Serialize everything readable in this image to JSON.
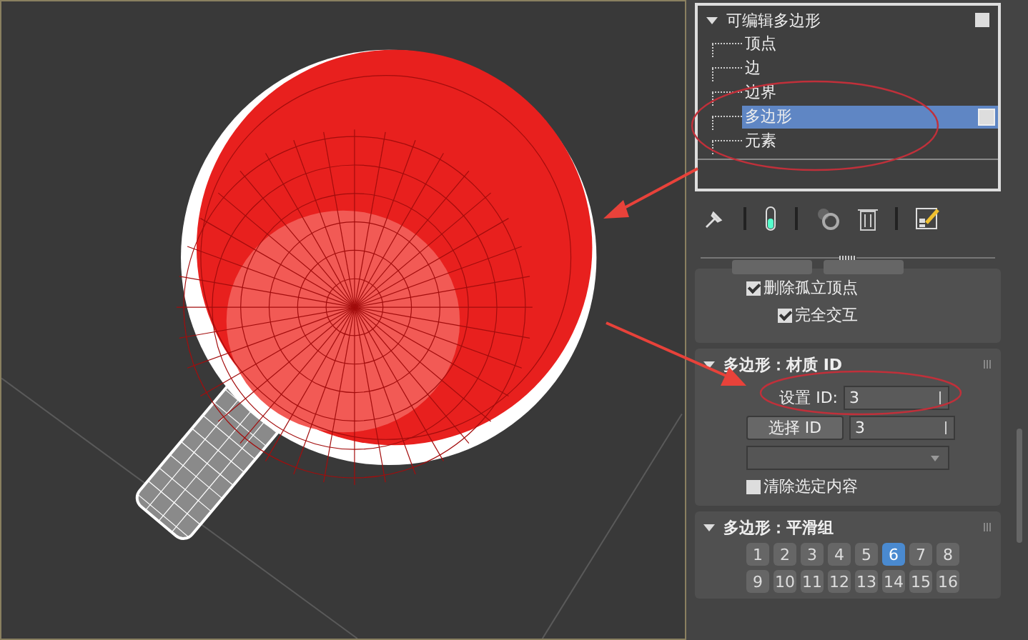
{
  "modifier_stack": {
    "title": "可编辑多边形",
    "expanded": true,
    "children": [
      {
        "label": "顶点",
        "selected": false
      },
      {
        "label": "边",
        "selected": false
      },
      {
        "label": "边界",
        "selected": false
      },
      {
        "label": "多边形",
        "selected": true
      },
      {
        "label": "元素",
        "selected": false
      }
    ]
  },
  "selection_options": [
    {
      "label": "删除孤立顶点",
      "checked": true
    },
    {
      "label": "完全交互",
      "checked": true
    }
  ],
  "material_id": {
    "title": "多边形：材质 ID",
    "expanded": true,
    "set_id_label": "设置 ID:",
    "set_id_value": "3",
    "select_id_button": "选择 ID",
    "select_id_value": "3",
    "clear_selection": {
      "label": "清除选定内容",
      "checked": false
    }
  },
  "smoothing_groups": {
    "title": "多边形：平滑组",
    "expanded": true,
    "groups": [
      {
        "label": "1",
        "selected": false
      },
      {
        "label": "2",
        "selected": false
      },
      {
        "label": "3",
        "selected": false
      },
      {
        "label": "4",
        "selected": false
      },
      {
        "label": "5",
        "selected": false
      },
      {
        "label": "6",
        "selected": true
      },
      {
        "label": "7",
        "selected": false
      },
      {
        "label": "8",
        "selected": false
      },
      {
        "label": "9",
        "selected": false
      },
      {
        "label": "10",
        "selected": false
      },
      {
        "label": "11",
        "selected": false
      },
      {
        "label": "12",
        "selected": false
      },
      {
        "label": "13",
        "selected": false
      },
      {
        "label": "14",
        "selected": false
      },
      {
        "label": "15",
        "selected": false
      },
      {
        "label": "16",
        "selected": false
      }
    ]
  }
}
